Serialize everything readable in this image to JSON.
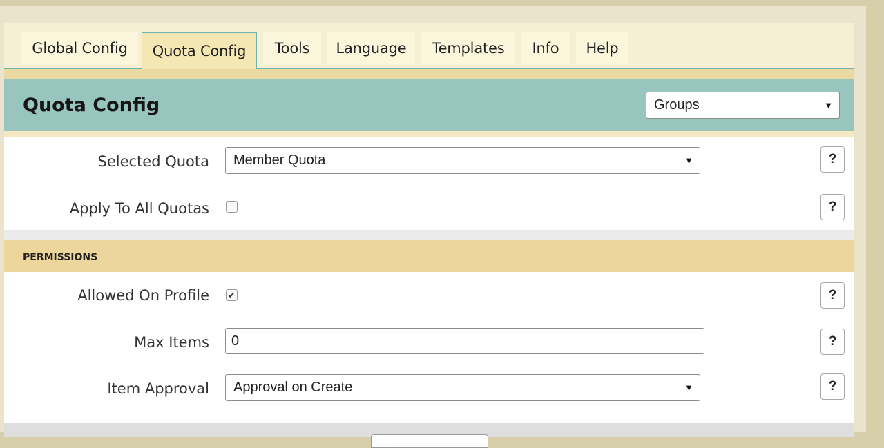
{
  "tabs": [
    {
      "label": "Global Config"
    },
    {
      "label": "Quota Config"
    },
    {
      "label": "Tools"
    },
    {
      "label": "Language"
    },
    {
      "label": "Templates"
    },
    {
      "label": "Info"
    },
    {
      "label": "Help"
    }
  ],
  "header": {
    "title": "Quota Config",
    "group_select": "Groups"
  },
  "quota": {
    "selected_quota_label": "Selected Quota",
    "selected_quota_value": "Member Quota",
    "apply_all_label": "Apply To All Quotas",
    "apply_all_checked": false
  },
  "permissions": {
    "section_title": "PERMISSIONS",
    "allowed_on_profile_label": "Allowed On Profile",
    "allowed_on_profile_checked": true,
    "max_items_label": "Max Items",
    "max_items_value": "0",
    "item_approval_label": "Item Approval",
    "item_approval_value": "Approval on Create"
  },
  "help": {
    "label": "?"
  },
  "icons": {
    "dropdown": "dropdown-arrow-icon",
    "check": "checkmark-icon"
  },
  "glyphs": {
    "arrow": "▼",
    "check": "✔"
  }
}
